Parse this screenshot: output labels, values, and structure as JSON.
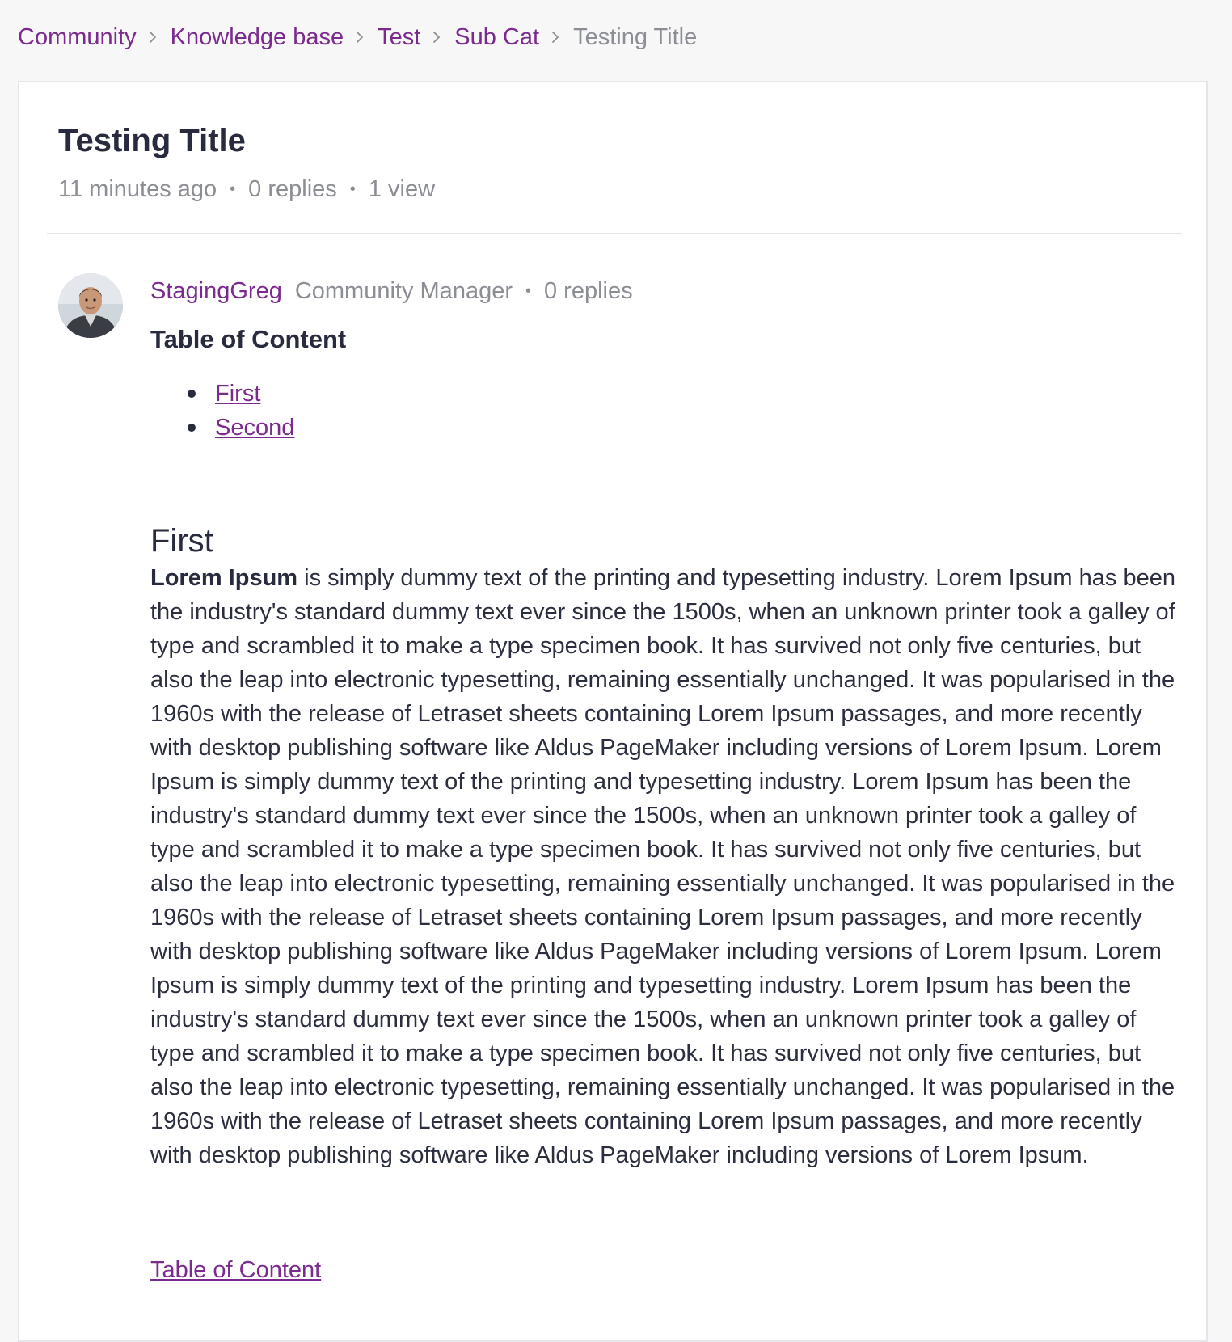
{
  "breadcrumb": {
    "items": [
      "Community",
      "Knowledge base",
      "Test",
      "Sub Cat"
    ],
    "current": "Testing Title"
  },
  "topic": {
    "title": "Testing Title",
    "time": "11 minutes ago",
    "replies": "0 replies",
    "views": "1 view"
  },
  "post": {
    "author": "StagingGreg",
    "role": "Community Manager",
    "replies": "0 replies",
    "toc_heading": "Table of Content",
    "toc_items": [
      "First",
      "Second"
    ],
    "section_heading": "First",
    "body_bold": "Lorem Ipsum",
    "body_text": " is simply dummy text of the printing and typesetting industry. Lorem Ipsum has been the industry's standard dummy text ever since the 1500s, when an unknown printer took a galley of type and scrambled it to make a type specimen book. It has survived not only five centuries, but also the leap into electronic typesetting, remaining essentially unchanged. It was popularised in the 1960s with the release of Letraset sheets containing Lorem Ipsum passages, and more recently with desktop publishing software like Aldus PageMaker including versions of Lorem Ipsum. Lorem Ipsum is simply dummy text of the printing and typesetting industry. Lorem Ipsum has been the industry's standard dummy text ever since the 1500s, when an unknown printer took a galley of type and scrambled it to make a type specimen book. It has survived not only five centuries, but also the leap into electronic typesetting, remaining essentially unchanged. It was popularised in the 1960s with the release of Letraset sheets containing Lorem Ipsum passages, and more recently with desktop publishing software like Aldus PageMaker including versions of Lorem Ipsum. Lorem Ipsum is simply dummy text of the printing and typesetting industry. Lorem Ipsum has been the industry's standard dummy text ever since the 1500s, when an unknown printer took a galley of type and scrambled it to make a type specimen book. It has survived not only five centuries, but also the leap into electronic typesetting, remaining essentially unchanged. It was popularised in the 1960s with the release of Letraset sheets containing Lorem Ipsum passages, and more recently with desktop publishing software like Aldus PageMaker including versions of Lorem Ipsum.",
    "back_link": "Table of Content"
  },
  "icons": {
    "breadcrumb_separator": "chevron-right-icon",
    "avatar": "user-avatar-photo"
  },
  "colors": {
    "accent": "#7b2a8d",
    "muted": "#8c8e95",
    "text": "#2b2e3f",
    "background": "#f7f7f8",
    "card": "#ffffff"
  }
}
